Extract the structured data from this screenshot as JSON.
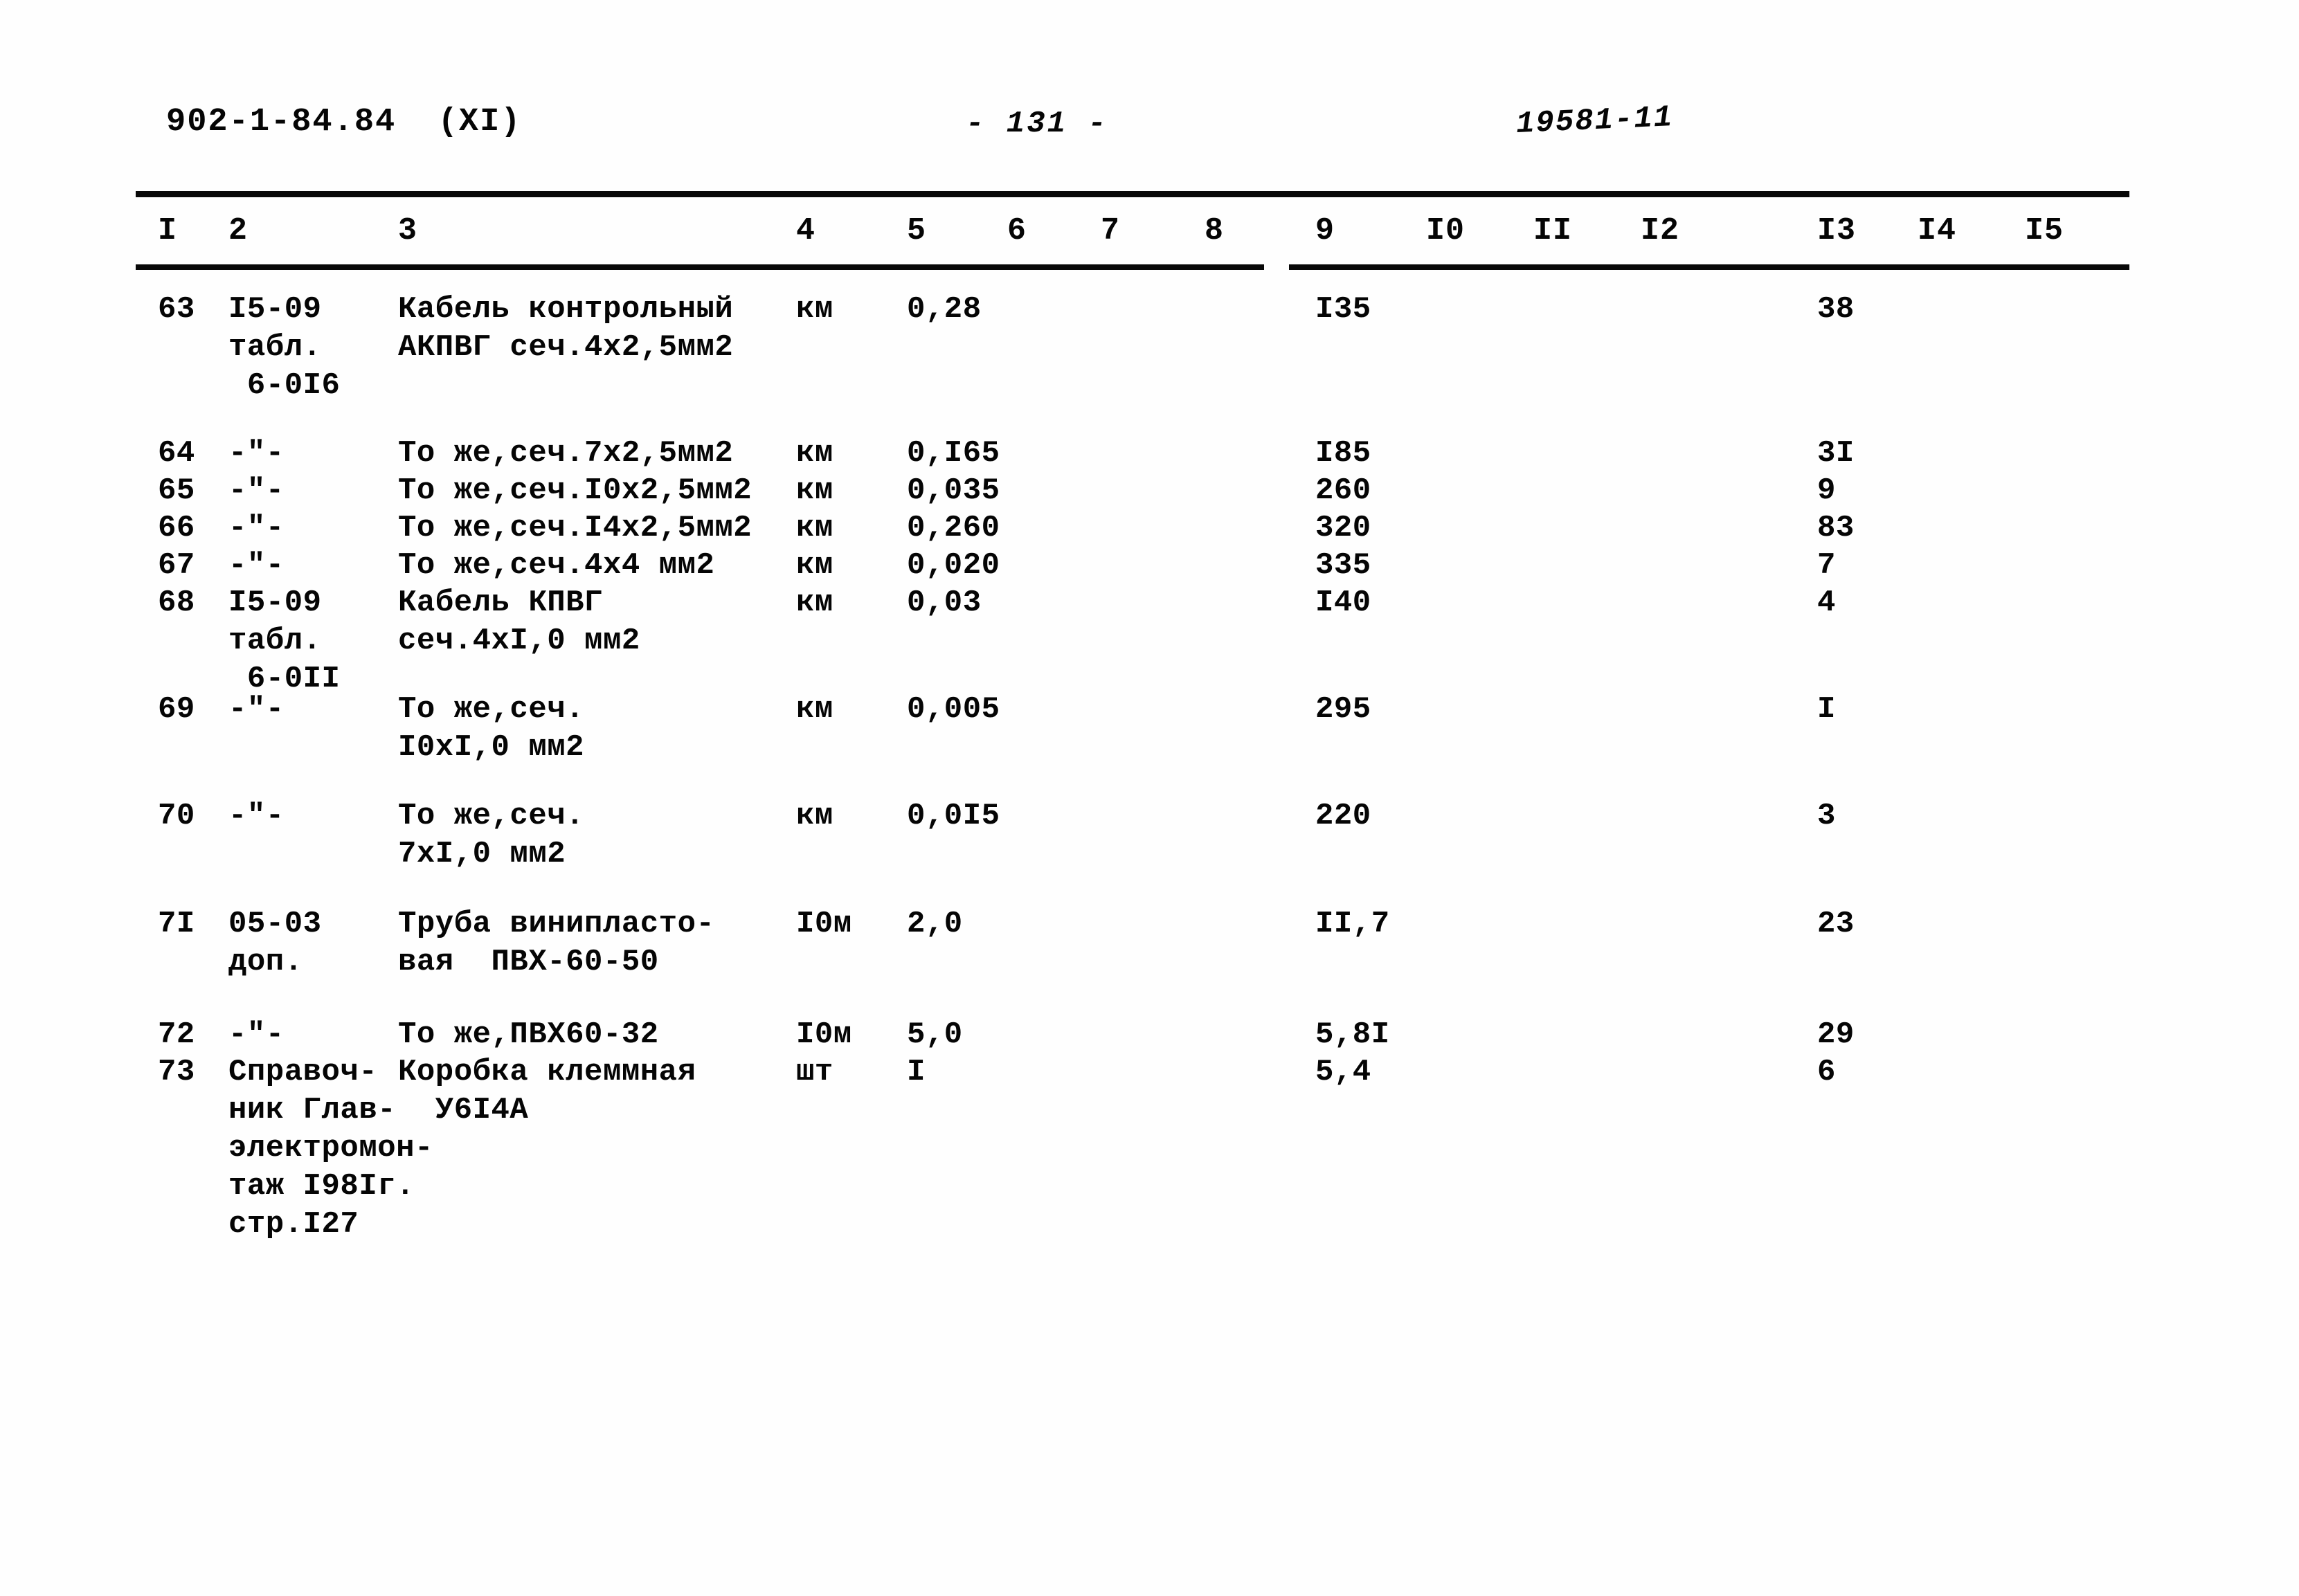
{
  "header": {
    "doc_code": "902-1-84.84  (XI)",
    "page_number": "- 131 -",
    "stamp": "19581-11"
  },
  "table": {
    "column_headers": [
      "I",
      "2",
      "3",
      "4",
      "5",
      "6",
      "7",
      "8",
      "9",
      "I0",
      "II",
      "I2",
      "I3",
      "I4",
      "I5"
    ],
    "rows": [
      {
        "num": "63",
        "code": "I5-09\nтабл.\n 6-0I6",
        "name": "Кабель контрольный\nАКПВГ сеч.4х2,5мм2",
        "unit": "км",
        "qty": "0,28",
        "col9": "I35",
        "col13": "38"
      },
      {
        "num": "64",
        "code": "-\"-",
        "name": "То же,сеч.7х2,5мм2",
        "unit": "км",
        "qty": "0,I65",
        "col9": "I85",
        "col13": "3I"
      },
      {
        "num": "65",
        "code": "-\"-",
        "name": "То же,сеч.I0х2,5мм2",
        "unit": "км",
        "qty": "0,035",
        "col9": "260",
        "col13": "9"
      },
      {
        "num": "66",
        "code": "-\"-",
        "name": "То же,сеч.I4х2,5мм2",
        "unit": "км",
        "qty": "0,260",
        "col9": "320",
        "col13": "83"
      },
      {
        "num": "67",
        "code": "-\"-",
        "name": "То же,сеч.4х4 мм2",
        "unit": "км",
        "qty": "0,020",
        "col9": "335",
        "col13": "7"
      },
      {
        "num": "68",
        "code": "I5-09\nтабл.\n 6-0II",
        "name": "Кабель КПВГ\nсеч.4хI,0 мм2",
        "unit": "км",
        "qty": "0,03",
        "col9": "I40",
        "col13": "4"
      },
      {
        "num": "69",
        "code": "-\"-",
        "name": "То же,сеч.\nI0хI,0 мм2",
        "unit": "км",
        "qty": "0,005",
        "col9": "295",
        "col13": "I"
      },
      {
        "num": "70",
        "code": "-\"-",
        "name": "То же,сеч.\n7хI,0 мм2",
        "unit": "км",
        "qty": "0,0I5",
        "col9": "220",
        "col13": "3"
      },
      {
        "num": "7I",
        "code": "05-03\nдоп.",
        "name": "Труба винипласто-\nвая  ПВХ-60-50",
        "unit": "I0м",
        "qty": "2,0",
        "col9": "II,7",
        "col13": "23"
      },
      {
        "num": "72",
        "code": "-\"-",
        "name": "То же,ПВХ60-32",
        "unit": "I0м",
        "qty": "5,0",
        "col9": "5,8I",
        "col13": "29"
      },
      {
        "num": "73",
        "code": "Справоч-\nник Глав-\nэлектромон-\nтаж I98Iг.\nстр.I27",
        "name": "Коробка клеммная\n  У6I4А",
        "unit": "шт",
        "qty": "I",
        "col9": "5,4",
        "col13": "6"
      }
    ]
  }
}
